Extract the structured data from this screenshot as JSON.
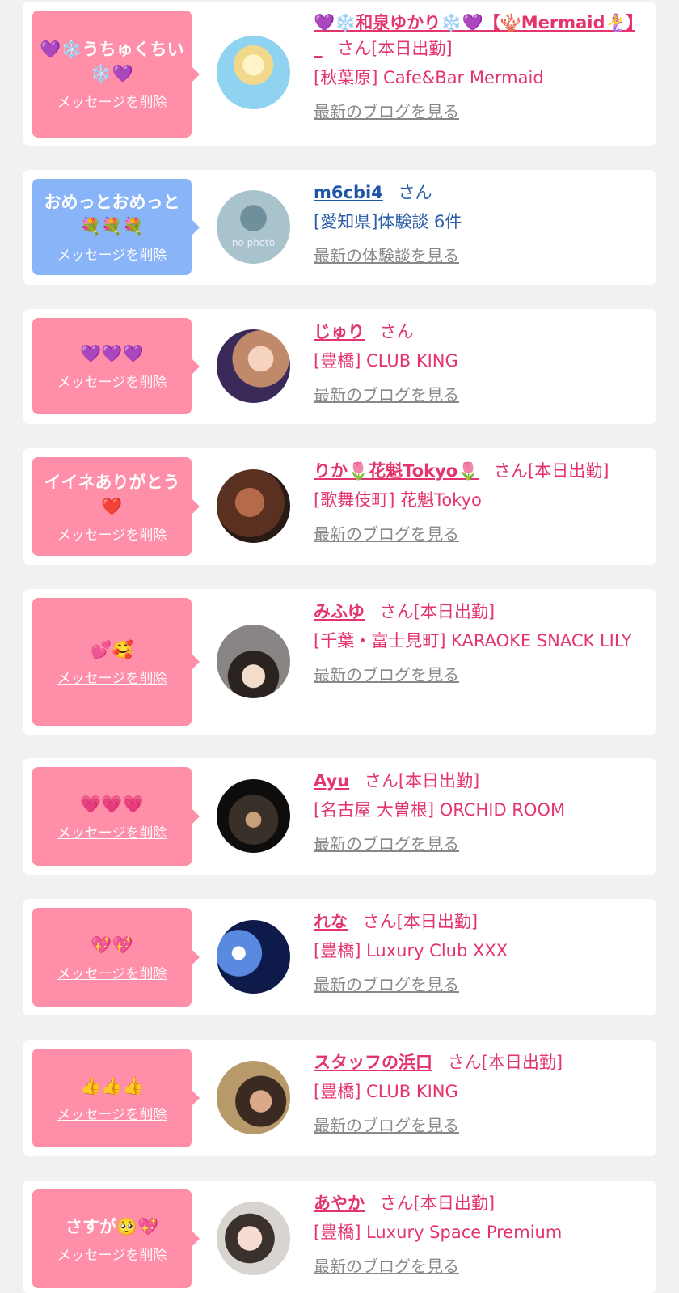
{
  "delete_label": "メッセージを削除",
  "colors": {
    "pink_bubble": "#ff8fa8",
    "blue_bubble": "#8ab4f8",
    "name_pink": "#e3356b",
    "name_blue": "#1e56a8",
    "link_gray": "#888888"
  },
  "cards": [
    {
      "message": "💜❄️うちゅくちい❄️💜",
      "name": "💜❄️和泉ゆかり❄️💜【🪸Mermaid🧜‍♀️】_",
      "suffix": "さん[本日出勤]",
      "shop": "[秋葉原] Cafe&Bar Mermaid",
      "link": "最新のブログを見る"
    },
    {
      "message": "おめっとおめっと💐💐💐",
      "name": "m6cbi4",
      "suffix": "さん",
      "shop": "[愛知県]体験談 6件",
      "link": "最新の体験談を見る"
    },
    {
      "message": "💜💜💜",
      "name": "じゅり",
      "suffix": "さん",
      "shop": "[豊橋] CLUB KING",
      "link": "最新のブログを見る"
    },
    {
      "message": "イイネありがとう❤️",
      "name": "りか🌷花魁Tokyo🌷",
      "suffix": "さん[本日出勤]",
      "shop": "[歌舞伎町] 花魁Tokyo",
      "link": "最新のブログを見る"
    },
    {
      "message": "💕🥰",
      "name": "みふゆ",
      "suffix": "さん[本日出勤]",
      "shop": "[千葉・富士見町] KARAOKE SNACK LILY",
      "link": "最新のブログを見る"
    },
    {
      "message": "💗💗💗",
      "name": "Ayu",
      "suffix": "さん[本日出勤]",
      "shop": "[名古屋 大曽根] ORCHID ROOM",
      "link": "最新のブログを見る"
    },
    {
      "message": "💖💖",
      "name": "れな",
      "suffix": "さん[本日出勤]",
      "shop": "[豊橋] Luxury Club XXX",
      "link": "最新のブログを見る"
    },
    {
      "message": "👍👍👍",
      "name": "スタッフの浜口",
      "suffix": "さん[本日出勤]",
      "shop": "[豊橋] CLUB KING",
      "link": "最新のブログを見る"
    },
    {
      "message": "さすが🥺💖",
      "name": "あやか",
      "suffix": "さん[本日出勤]",
      "shop": "[豊橋] Luxury Space Premium",
      "link": "最新のブログを見る"
    }
  ],
  "no_photo_label": "no photo"
}
